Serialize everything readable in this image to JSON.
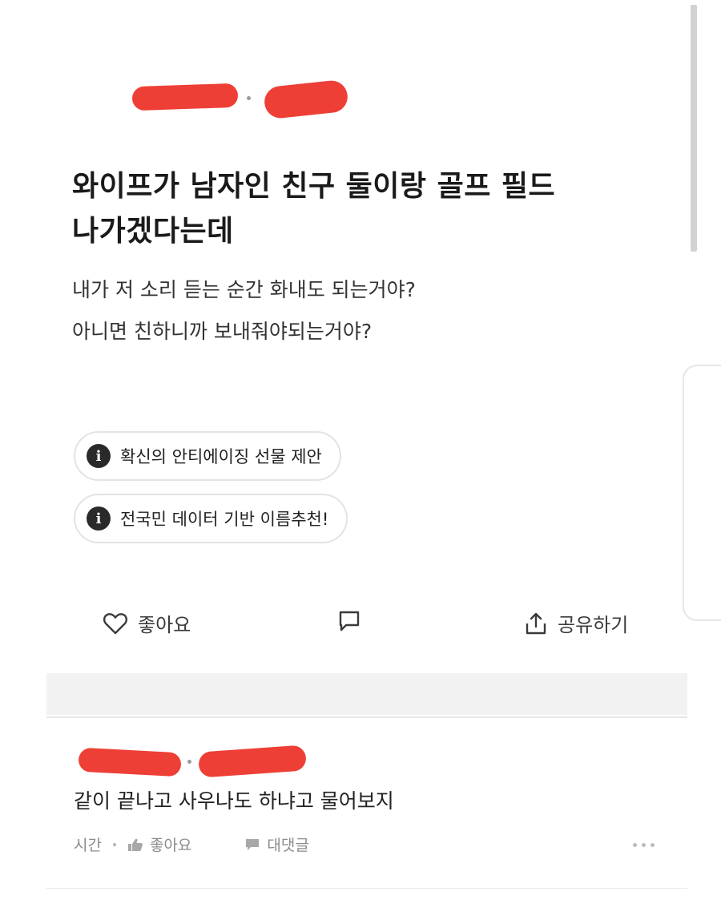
{
  "post": {
    "title_line1": "와이프가 남자인 친구 둘이랑 골프 필드",
    "title_line2": "나가겠다는데",
    "body_line1": "내가 저 소리 듣는 순간 화내도 되는거야?",
    "body_line2": "아니면 친하니까 보내줘야되는거야?"
  },
  "ads": [
    {
      "icon": "info-icon",
      "label": "확신의 안티에이징 선물 제안"
    },
    {
      "icon": "info-icon",
      "label": "전국민 데이터 기반 이름추천!"
    }
  ],
  "actions": {
    "like_label": "좋아요",
    "comment_icon": "comment-icon",
    "share_label": "공유하기"
  },
  "comment": {
    "text": "같이 끝나고 사우나도 하냐고 물어보지",
    "time": "시간",
    "like_label": "좋아요",
    "reply_label": "대댓글"
  },
  "colors": {
    "redaction": "#ee3f36",
    "divider": "#f2f2f2"
  }
}
